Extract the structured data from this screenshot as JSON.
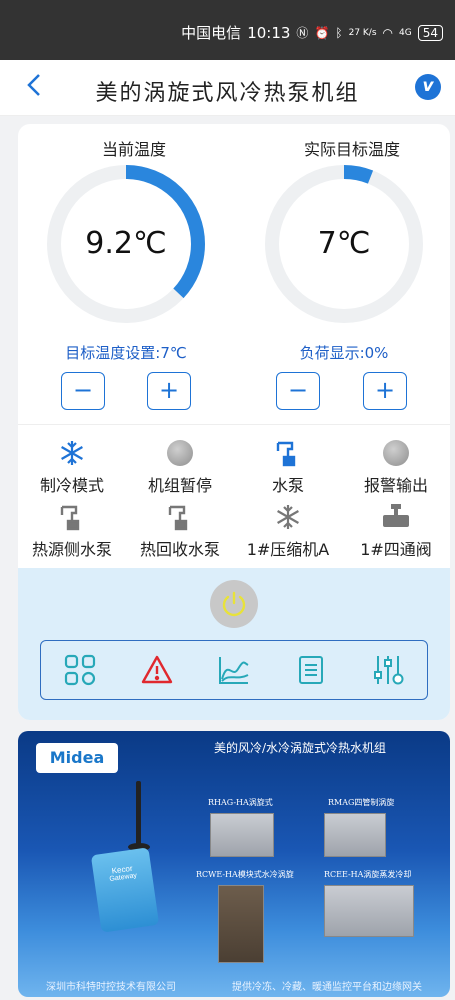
{
  "status_bar": {
    "carrier": "中国电信",
    "time": "10:13",
    "net_speed": "27 K/s",
    "network": "4G",
    "battery": "54"
  },
  "app_bar": {
    "title": "美的涡旋式风冷热泵机组",
    "logo_letter": "v"
  },
  "gauges": [
    {
      "label": "当前温度",
      "value_text": "9.2℃",
      "progress": 0.37,
      "color": "#2a86dd"
    },
    {
      "label": "实际目标温度",
      "value_text": "7℃",
      "progress": 0.06,
      "color": "#2a86dd"
    }
  ],
  "controls": {
    "target_setting": "目标温度设置:7℃",
    "load_display": "负荷显示:0%",
    "minus": "−",
    "plus": "+"
  },
  "status_items": [
    {
      "label": "制冷模式",
      "icon": "snowflake-icon"
    },
    {
      "label": "机组暂停",
      "icon": "grey-indicator-icon"
    },
    {
      "label": "水泵",
      "icon": "pump-icon"
    },
    {
      "label": "报警输出",
      "icon": "grey-indicator-icon"
    },
    {
      "label": "热源侧水泵",
      "icon": "pump-icon"
    },
    {
      "label": "热回收水泵",
      "icon": "pump-icon"
    },
    {
      "label": "1#压缩机A",
      "icon": "snowflake-icon"
    },
    {
      "label": "1#四通阀",
      "icon": "valve-icon"
    }
  ],
  "toolbar": [
    {
      "name": "grid-icon"
    },
    {
      "name": "warning-icon"
    },
    {
      "name": "chart-icon"
    },
    {
      "name": "list-icon"
    },
    {
      "name": "settings-sliders-icon"
    }
  ],
  "banner": {
    "brand": "Midea",
    "title": "美的风冷/水冷涡旋式冷热水机组",
    "products": [
      "RHAG-HA涡旋式",
      "RMAG四管制涡旋",
      "RCWE-HA模块式水冷涡旋",
      "RCEE-HA涡旋蒸发冷却"
    ],
    "gateway_brand": "Kecor",
    "gateway_label": "Gateway",
    "footer_left": "深圳市科特时控技术有限公司",
    "footer_right": "提供冷冻、冷藏、暖通监控平台和边缘网关"
  },
  "colors": {
    "accent": "#1e73d6",
    "toolbar_accent": "#27a8b8",
    "warning_red": "#e0282e",
    "power_yellow": "#e8e23a"
  }
}
